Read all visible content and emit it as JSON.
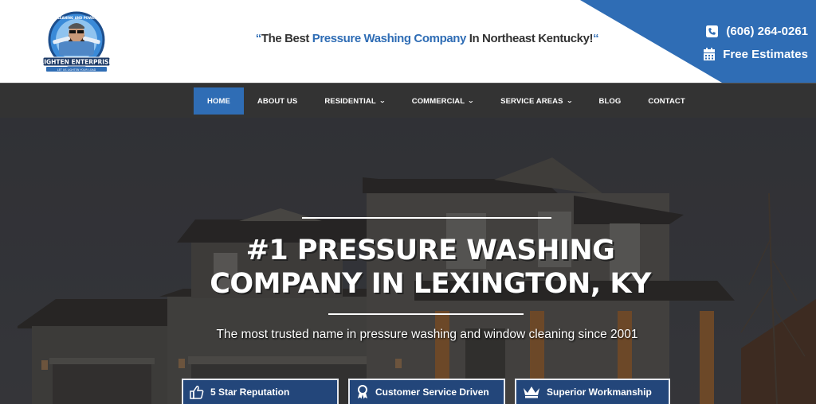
{
  "header": {
    "logo_alt": "Lighten Enterprise logo",
    "tagline": {
      "open_quote": "“",
      "part1": "The Best ",
      "highlight": "Pressure Washing Company",
      "part2": " In Northeast Kentucky!",
      "close_quote": "“"
    },
    "contact": {
      "phone": "(606) 264-0261",
      "phone_icon": "phone-icon",
      "estimates": "Free Estimates",
      "estimates_icon": "calendar-icon"
    }
  },
  "nav": {
    "items": [
      {
        "label": "HOME",
        "active": true,
        "dropdown": false
      },
      {
        "label": "ABOUT US",
        "active": false,
        "dropdown": false
      },
      {
        "label": "RESIDENTIAL",
        "active": false,
        "dropdown": true
      },
      {
        "label": "COMMERCIAL",
        "active": false,
        "dropdown": true
      },
      {
        "label": "SERVICE AREAS",
        "active": false,
        "dropdown": true
      },
      {
        "label": "BLOG",
        "active": false,
        "dropdown": false
      },
      {
        "label": "CONTACT",
        "active": false,
        "dropdown": false
      }
    ],
    "chevron": "⌄"
  },
  "hero": {
    "headline_line1": "#1 PRESSURE WASHING",
    "headline_line2": "COMPANY IN LEXINGTON, KY",
    "subline": "The most trusted name in pressure washing and window cleaning since 2001",
    "features": [
      {
        "label": "5 Star Reputation",
        "icon": "thumbs-up-icon"
      },
      {
        "label": "Customer Service Driven",
        "icon": "award-ribbon-icon"
      },
      {
        "label": "Superior Workmanship",
        "icon": "crown-icon"
      }
    ]
  },
  "colors": {
    "brand_blue": "#2f6db5",
    "nav_bg": "#333333",
    "feature_bg": "#23467a",
    "tagline_text": "#333333"
  }
}
